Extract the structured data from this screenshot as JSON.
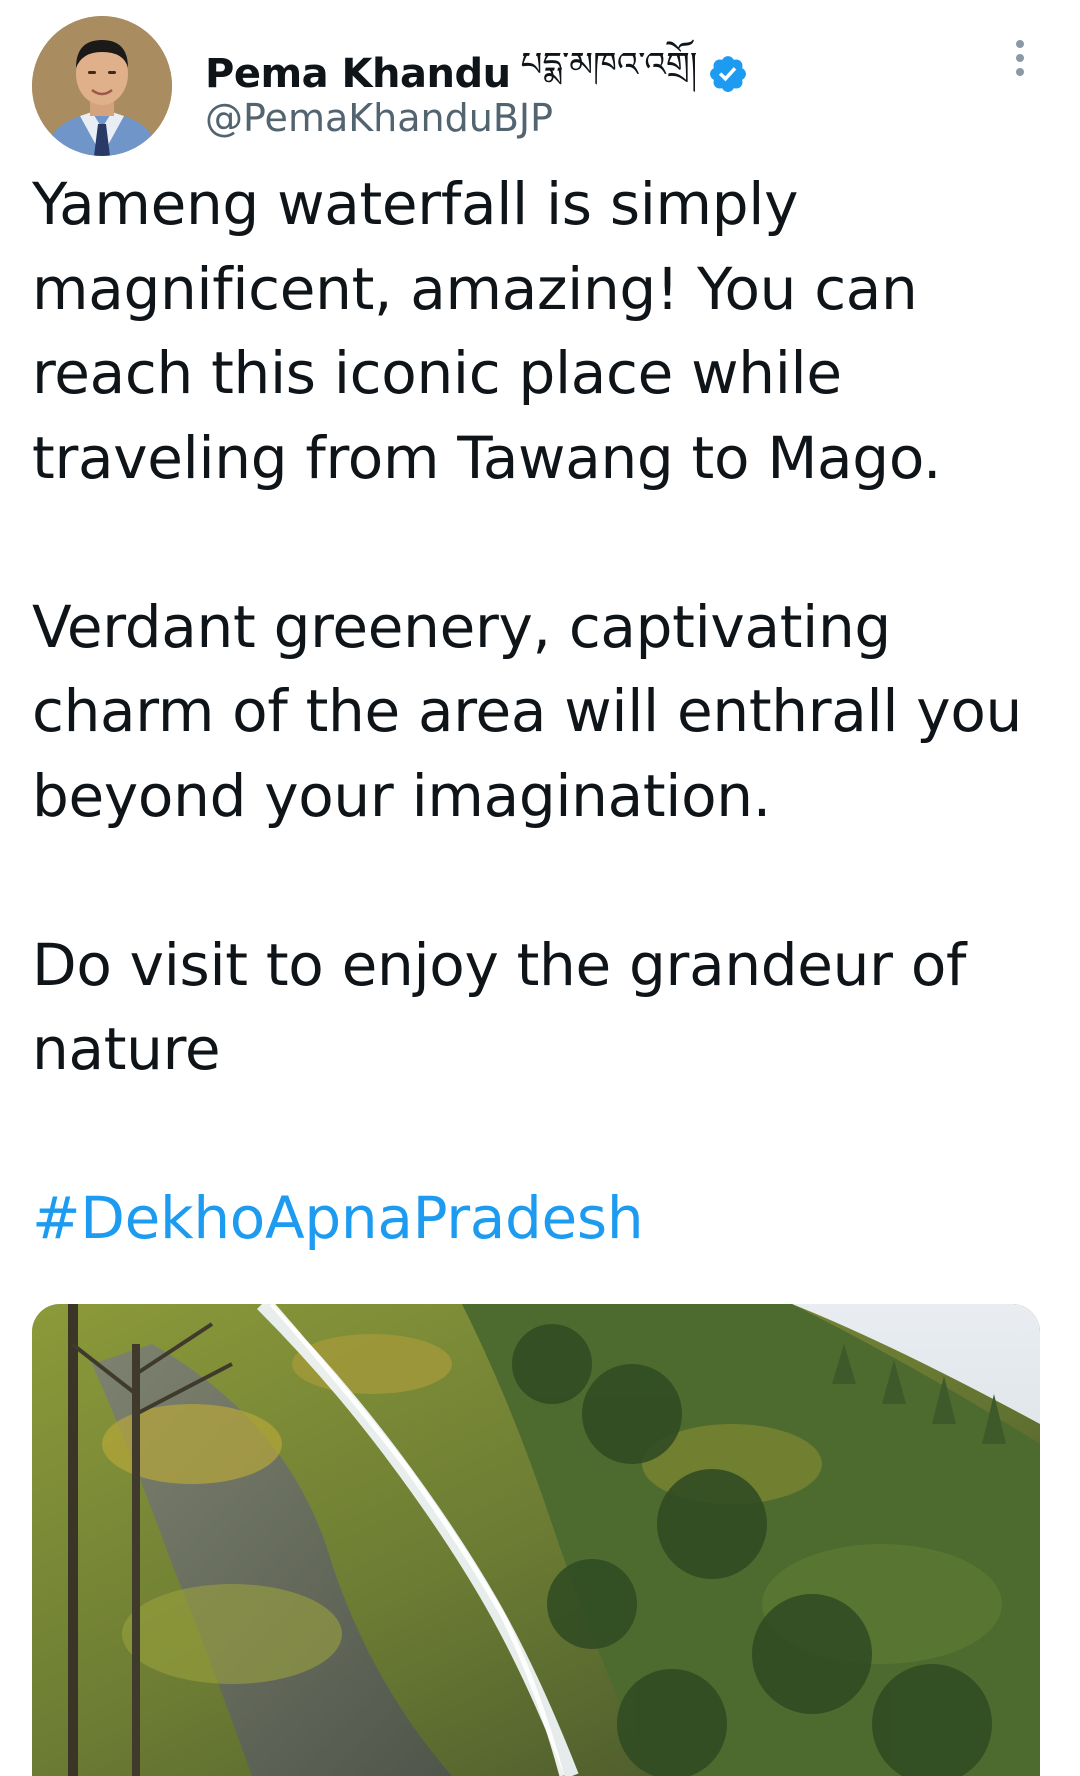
{
  "author": {
    "display_name": "Pema Khandu",
    "tibetan_name": "པདྨ་མཁའ་འགྲོ།",
    "handle": "@PemaKhanduBJP",
    "verified": true,
    "avatar_icon": "profile-photo",
    "verified_icon": "verified-badge-icon"
  },
  "menu": {
    "icon": "more-vertical-icon"
  },
  "tweet": {
    "paragraphs": [
      "Yameng waterfall is simply magnificent, amazing! You can reach this iconic place while traveling from Tawang to Mago.",
      "Verdant greenery, captivating charm of the area will enthrall you beyond your imagination.",
      "Do visit to enjoy the grandeur of nature"
    ],
    "hashtag": "#DekhoApnaPradesh"
  },
  "media": {
    "type": "photo",
    "icon": "waterfall-photo"
  },
  "colors": {
    "accent": "#1d9bf0",
    "text": "#0f1419",
    "secondary": "#536471"
  }
}
